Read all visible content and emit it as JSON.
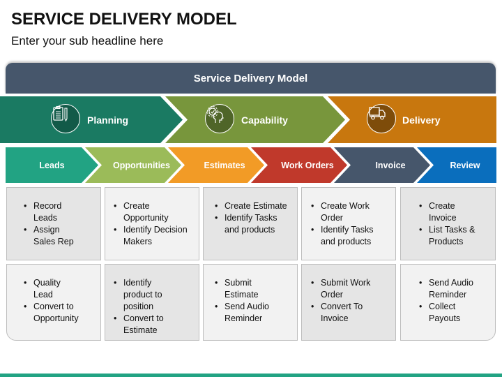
{
  "header": {
    "title": "SERVICE DELIVERY MODEL",
    "subtitle": "Enter your sub headline here"
  },
  "banner": {
    "label": "Service Delivery Model",
    "color": "#46566b"
  },
  "stages": [
    {
      "label": "Planning",
      "icon": "clipboard-pencil-icon",
      "color": "#1a7a62",
      "icon_bg": "#125a48"
    },
    {
      "label": "Capability",
      "icon": "gear-head-icon",
      "color": "#78963c",
      "icon_bg": "#4f6528"
    },
    {
      "label": "Delivery",
      "icon": "delivery-truck-icon",
      "color": "#c8770e",
      "icon_bg": "#7e4c0a"
    }
  ],
  "steps": [
    {
      "label": "Leads",
      "color": "#22a383"
    },
    {
      "label": "Opportunities",
      "color": "#9bbb59"
    },
    {
      "label": "Estimates",
      "color": "#f29b26"
    },
    {
      "label": "Work Orders",
      "color": "#c0392b"
    },
    {
      "label": "Invoice",
      "color": "#46566b"
    },
    {
      "label": "Review",
      "color": "#0a6ebd"
    }
  ],
  "grid": {
    "top_row": [
      {
        "items": [
          "Record Leads",
          "Assign Sales Rep"
        ]
      },
      {
        "items": [
          "Create Opportunity",
          "Identify Decision Makers"
        ]
      },
      {
        "items": [
          "Create Estimate",
          "Identify Tasks and products"
        ]
      },
      {
        "items": [
          "Create Work Order",
          "Identify Tasks and products"
        ]
      },
      {
        "items": [
          "Create Invoice",
          "List Tasks & Products"
        ]
      }
    ],
    "bottom_row": [
      {
        "items": [
          "Quality Lead",
          "Convert to Opportunity"
        ]
      },
      {
        "items": [
          "Identify product to position",
          "Convert to Estimate"
        ]
      },
      {
        "items": [
          "Submit Estimate",
          "Send Audio Reminder"
        ]
      },
      {
        "items": [
          "Submit Work Order",
          "Convert To Invoice"
        ]
      },
      {
        "items": [
          "Send Audio Reminder",
          "Collect Payouts"
        ]
      }
    ]
  },
  "footer": {
    "color": "#22a383"
  }
}
